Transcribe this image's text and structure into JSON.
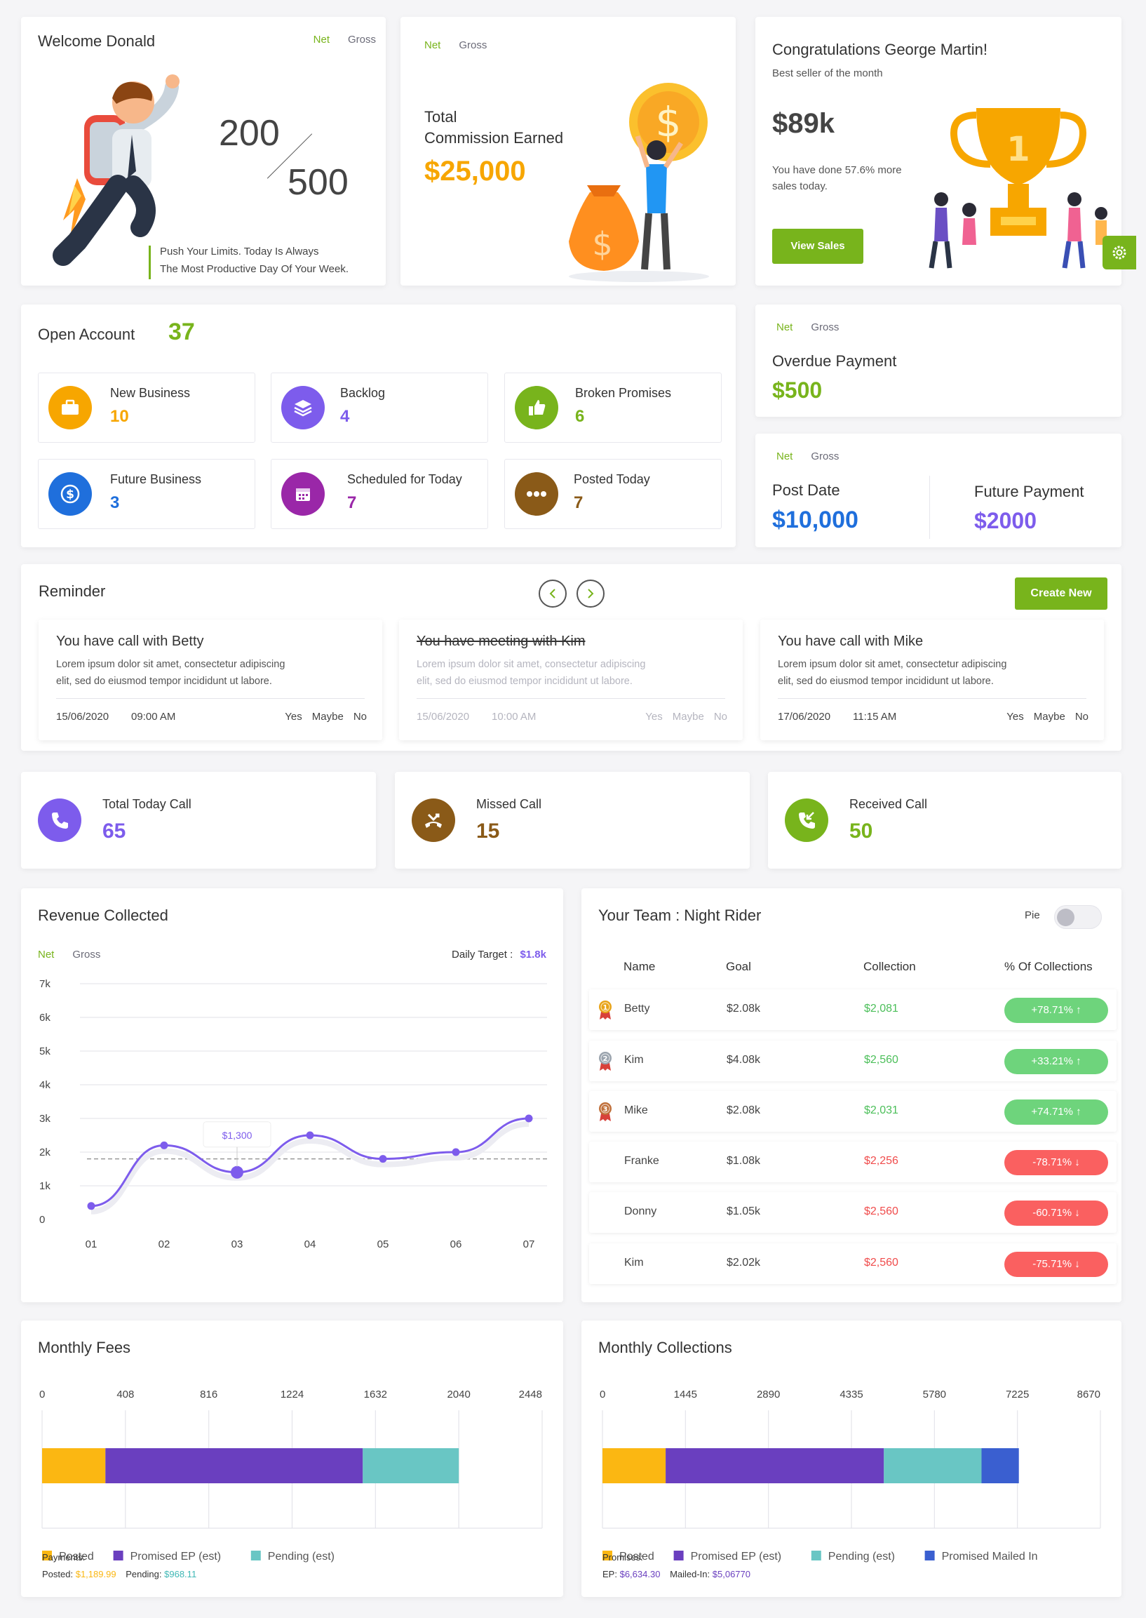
{
  "welcome": {
    "title": "Welcome Donald",
    "net": "Net",
    "gross": "Gross",
    "num_top": "200",
    "num_bottom": "500",
    "quote_line1": "Push Your Limits. Today Is Always",
    "quote_line2": "The Most Productive Day Of Your Week."
  },
  "commission": {
    "net": "Net",
    "gross": "Gross",
    "label_line1": "Total",
    "label_line2": "Commission Earned",
    "amount": "$25,000"
  },
  "congrats": {
    "title": "Congratulations George Martin!",
    "subtitle": "Best seller of the month",
    "amount": "$89k",
    "desc_line1": "You have done 57.6% more",
    "desc_line2": "sales today.",
    "button": "View Sales"
  },
  "open_account": {
    "title": "Open Account",
    "count": "37",
    "items": [
      {
        "label": "New Business",
        "value": "10",
        "color": "#f7a600",
        "icon": "briefcase-icon"
      },
      {
        "label": "Backlog",
        "value": "4",
        "color": "#7d5cec",
        "icon": "layers-icon"
      },
      {
        "label": "Broken Promises",
        "value": "6",
        "color": "#78b41c",
        "icon": "thumbs-up-icon"
      },
      {
        "label": "Future Business",
        "value": "3",
        "color": "#1f6fdc",
        "icon": "dollar-coin-icon"
      },
      {
        "label": "Scheduled for Today",
        "value": "7",
        "color": "#9a27a8",
        "icon": "calendar-icon"
      },
      {
        "label": "Posted Today",
        "value": "7",
        "color": "#8a5a18",
        "icon": "more-dots-icon"
      }
    ]
  },
  "overdue": {
    "net": "Net",
    "gross": "Gross",
    "title": "Overdue Payment",
    "amount": "$500"
  },
  "postdate": {
    "net": "Net",
    "gross": "Gross",
    "post_label": "Post Date",
    "post_amount": "$10,000",
    "future_label": "Future Payment",
    "future_amount": "$2000"
  },
  "reminder": {
    "title": "Reminder",
    "create_button": "Create New",
    "cards": [
      {
        "title": "You have call with Betty",
        "body1": "Lorem ipsum dolor sit amet, consectetur adipiscing",
        "body2": "elit, sed do eiusmod tempor incididunt ut labore.",
        "date": "15/06/2020",
        "time": "09:00 AM",
        "yes": "Yes",
        "maybe": "Maybe",
        "no": "No"
      },
      {
        "title": "You have meeting with Kim",
        "body1": "Lorem ipsum dolor sit amet, consectetur adipiscing",
        "body2": "elit, sed do eiusmod tempor incididunt ut labore.",
        "date": "15/06/2020",
        "time": "10:00 AM",
        "yes": "Yes",
        "maybe": "Maybe",
        "no": "No"
      },
      {
        "title": "You have call with Mike",
        "body1": "Lorem ipsum dolor sit amet, consectetur adipiscing",
        "body2": "elit, sed do eiusmod tempor incididunt ut labore.",
        "date": "17/06/2020",
        "time": "11:15 AM",
        "yes": "Yes",
        "maybe": "Maybe",
        "no": "No"
      }
    ]
  },
  "calls": [
    {
      "label": "Total Today Call",
      "value": "65",
      "color": "#7d5cec",
      "icon": "phone-icon"
    },
    {
      "label": "Missed Call",
      "value": "15",
      "color": "#8a5a18",
      "icon": "missed-call-icon"
    },
    {
      "label": "Received Call",
      "value": "50",
      "color": "#78b41c",
      "icon": "incoming-call-icon"
    }
  ],
  "revenue": {
    "title": "Revenue Collected",
    "net": "Net",
    "gross": "Gross",
    "target_label": "Daily Target :",
    "target_value": "$1.8k",
    "tooltip": "$1,300"
  },
  "chart_data": [
    {
      "type": "line",
      "title": "Revenue Collected",
      "categories": [
        "01",
        "02",
        "03",
        "04",
        "05",
        "06",
        "07"
      ],
      "values": [
        400,
        2200,
        1400,
        2500,
        1800,
        2000,
        3000
      ],
      "y_ticks": [
        "0",
        "1k",
        "2k",
        "3k",
        "4k",
        "5k",
        "6k",
        "7k"
      ],
      "ylim": [
        0,
        7000
      ],
      "reference_line": 1800,
      "grid": true,
      "color": "#7d5cec"
    },
    {
      "type": "bar",
      "title": "Monthly Fees",
      "orientation": "horizontal-stacked",
      "x_ticks": [
        "0",
        "408",
        "816",
        "1224",
        "1632",
        "2040",
        "2448"
      ],
      "xlim": [
        0,
        2448
      ],
      "series": [
        {
          "name": "Posted",
          "value": 310,
          "color": "#fbb712"
        },
        {
          "name": "Promised EP (est)",
          "value": 1260,
          "color": "#6a3fbf"
        },
        {
          "name": "Pending (est)",
          "value": 470,
          "color": "#69c6c4"
        }
      ]
    },
    {
      "type": "bar",
      "title": "Monthly Collections",
      "orientation": "horizontal-stacked",
      "x_ticks": [
        "0",
        "1445",
        "2890",
        "4335",
        "5780",
        "7225",
        "8670"
      ],
      "xlim": [
        0,
        8670
      ],
      "series": [
        {
          "name": "Posted",
          "value": 1100,
          "color": "#fbb712"
        },
        {
          "name": "Promised EP (est)",
          "value": 3800,
          "color": "#6a3fbf"
        },
        {
          "name": "Pending (est)",
          "value": 1700,
          "color": "#69c6c4"
        },
        {
          "name": "Promised Mailed In",
          "value": 650,
          "color": "#3a5fd0"
        }
      ]
    }
  ],
  "team": {
    "title": "Your Team : Night Rider",
    "pie_label": "Pie",
    "headers": [
      "Name",
      "Goal",
      "Collection",
      "% Of Collections"
    ],
    "rows": [
      {
        "name": "Betty",
        "goal": "$2.08k",
        "collection": "$2,081",
        "pct": "+78.71% ↑",
        "trend": "up",
        "medal": "1"
      },
      {
        "name": "Kim",
        "goal": "$4.08k",
        "collection": "$2,560",
        "pct": "+33.21% ↑",
        "trend": "up",
        "medal": "2"
      },
      {
        "name": "Mike",
        "goal": "$2.08k",
        "collection": "$2,031",
        "pct": "+74.71% ↑",
        "trend": "up",
        "medal": "3"
      },
      {
        "name": "Franke",
        "goal": "$1.08k",
        "collection": "$2,256",
        "pct": "-78.71% ↓",
        "trend": "down",
        "medal": ""
      },
      {
        "name": "Donny",
        "goal": "$1.05k",
        "collection": "$2,560",
        "pct": "-60.71% ↓",
        "trend": "down",
        "medal": ""
      },
      {
        "name": "Kim",
        "goal": "$2.02k",
        "collection": "$2,560",
        "pct": "-75.71% ↓",
        "trend": "down",
        "medal": ""
      }
    ]
  },
  "fees": {
    "title": "Monthly Fees",
    "payments_label": "Payments:",
    "posted_label": "Posted:",
    "posted_value": "$1,189.99",
    "pending_label": "Pending:",
    "pending_value": "$968.11"
  },
  "collections": {
    "title": "Monthly Collections",
    "promises_label": "Promises:",
    "ep_label": "EP:",
    "ep_value": "$6,634.30",
    "mailed_label": "Mailed-In:",
    "mailed_value": "$5,06770"
  }
}
